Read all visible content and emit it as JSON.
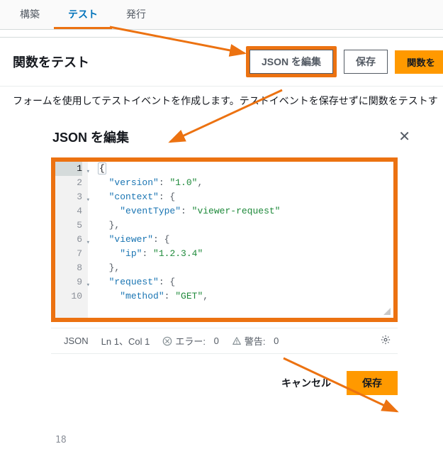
{
  "tabs": {
    "build": "構築",
    "test": "テスト",
    "publish": "発行"
  },
  "panel": {
    "title": "関数をテスト",
    "editJsonBtn": "JSON を編集",
    "saveBtn": "保存",
    "testFnBtn": "関数を",
    "description": "フォームを使用してテストイベントを作成します。テストイベントを保存せずに関数をテストす"
  },
  "modal": {
    "title": "JSON を編集",
    "cancel": "キャンセル",
    "save": "保存"
  },
  "editor": {
    "lines": [
      "1",
      "2",
      "3",
      "4",
      "5",
      "6",
      "7",
      "8",
      "9",
      "10"
    ],
    "code": {
      "l1_open": "{",
      "l2_k": "\"version\"",
      "l2_v": "\"1.0\"",
      "l3_k": "\"context\"",
      "l4_k": "\"eventType\"",
      "l4_v": "\"viewer-request\"",
      "l5_close": "},",
      "l6_k": "\"viewer\"",
      "l7_k": "\"ip\"",
      "l7_v": "\"1.2.3.4\"",
      "l8_close": "},",
      "l9_k": "\"request\"",
      "l10_k": "\"method\"",
      "l10_v": "\"GET\""
    },
    "stubLine": "18"
  },
  "status": {
    "lang": "JSON",
    "pos": "Ln 1、Col 1",
    "errorsLabel": "エラー:",
    "errors": "0",
    "warningsLabel": "警告:",
    "warnings": "0"
  },
  "colors": {
    "accent": "#ec7211",
    "primary": "#ff9900",
    "link": "#0073bb"
  }
}
